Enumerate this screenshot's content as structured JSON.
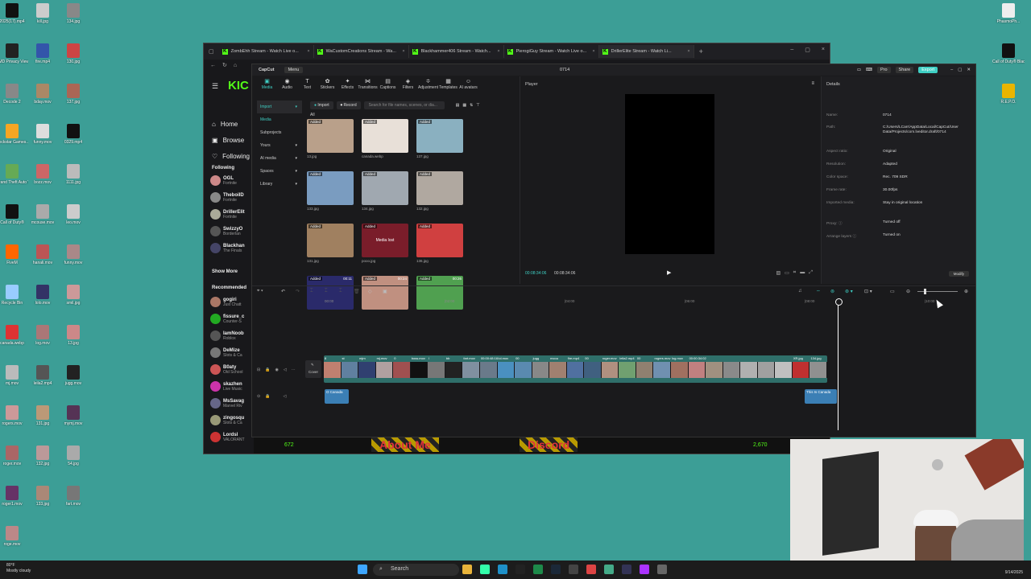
{
  "desktop": {
    "left_icons": [
      {
        "label": "2025(17).mp4",
        "color": "#111"
      },
      {
        "label": "kill.jpg",
        "color": "#ccc"
      },
      {
        "label": "134.jpg",
        "color": "#888"
      },
      {
        "label": "AMD Privacy View",
        "color": "#222"
      },
      {
        "label": "fire.mp4",
        "color": "#3355aa"
      },
      {
        "label": "130.jpg",
        "color": "#c44"
      },
      {
        "label": "Decode 2",
        "color": "#888"
      },
      {
        "label": "bday.mov",
        "color": "#aa8866"
      },
      {
        "label": "137.jpg",
        "color": "#aa6655"
      },
      {
        "label": "Rockstar Games...",
        "color": "#f5a623"
      },
      {
        "label": "funny.mov",
        "color": "#ddd"
      },
      {
        "label": "0329.mp4",
        "color": "#111"
      },
      {
        "label": "Grand Theft Auto V Leg...",
        "color": "#6a5"
      },
      {
        "label": "bozz.mov",
        "color": "#c66"
      },
      {
        "label": "1111.jpg",
        "color": "#bbb"
      },
      {
        "label": "Call of Duty®",
        "color": "#111"
      },
      {
        "label": "mcouse.mov",
        "color": "#aaa"
      },
      {
        "label": "leo.mov",
        "color": "#ccc"
      },
      {
        "label": "FiveM",
        "color": "#f60"
      },
      {
        "label": "hanali.mov",
        "color": "#b55"
      },
      {
        "label": "funny.mov",
        "color": "#a88"
      },
      {
        "label": "Recycle Bin",
        "color": "#9cf"
      },
      {
        "label": "lolo.mov",
        "color": "#336"
      },
      {
        "label": "smil.jpg",
        "color": "#c99"
      },
      {
        "label": "canada.webp",
        "color": "#d33"
      },
      {
        "label": "log.mov",
        "color": "#a77"
      },
      {
        "label": "13.jpg",
        "color": "#c88"
      },
      {
        "label": "mj.mov",
        "color": "#bbb"
      },
      {
        "label": "leila2.mp4",
        "color": "#555"
      },
      {
        "label": "jugg.mov",
        "color": "#222"
      },
      {
        "label": "rogers.mov",
        "color": "#c99"
      },
      {
        "label": "131.jpg",
        "color": "#b97"
      },
      {
        "label": "mymj.mov",
        "color": "#535"
      },
      {
        "label": "roger.mov",
        "color": "#a66"
      },
      {
        "label": "132.jpg",
        "color": "#b99"
      },
      {
        "label": "54.jpg",
        "color": "#aaa"
      },
      {
        "label": "roger1.mov",
        "color": "#636"
      },
      {
        "label": "133.jpg",
        "color": "#a87"
      },
      {
        "label": "fart.mov",
        "color": "#777"
      },
      {
        "label": "roge.mov",
        "color": "#b88"
      }
    ],
    "right_icons": [
      {
        "label": "PhasmoPh...",
        "color": "#eee"
      },
      {
        "label": "Call of Duty® Black...",
        "color": "#111"
      },
      {
        "label": "R.E.P.O.",
        "color": "#e9b500"
      }
    ]
  },
  "browser": {
    "tabs": [
      {
        "title": "ZombEhh Stream - Watch Live o..."
      },
      {
        "title": "WaCustomCreations Stream - Wa..."
      },
      {
        "title": "Blackhammer406 Stream - Watch..."
      },
      {
        "title": "PierogiGuy Stream - Watch Live o..."
      },
      {
        "title": "DrillerElite Stream - Watch Li..."
      }
    ],
    "close_glyph": "×",
    "new_tab_glyph": "+"
  },
  "kick": {
    "logo": "KIC",
    "nav": [
      {
        "label": "Home",
        "icon": "home-icon"
      },
      {
        "label": "Browse",
        "icon": "browse-icon"
      },
      {
        "label": "Following",
        "icon": "heart-icon"
      }
    ],
    "following_header": "Following",
    "following": [
      {
        "name": "OGL",
        "game": "Fortnite",
        "color": "#c88"
      },
      {
        "name": "TheboiID",
        "game": "Fortnite",
        "color": "#888"
      },
      {
        "name": "DrillerElit",
        "game": "Fortnite",
        "color": "#aa9"
      },
      {
        "name": "SwizzyO",
        "game": "Borderlan",
        "color": "#555"
      },
      {
        "name": "Blackhan",
        "game": "The Finals",
        "color": "#446"
      }
    ],
    "show_more": "Show More",
    "recommended_header": "Recommended",
    "recommended": [
      {
        "name": "gogiri",
        "game": "Just Chatt",
        "color": "#a76"
      },
      {
        "name": "fissure_c",
        "game": "Counter-S",
        "color": "#2a2"
      },
      {
        "name": "IamNoob",
        "game": "Roblox",
        "color": "#555"
      },
      {
        "name": "DeMize",
        "game": "Slots & Ca",
        "color": "#777"
      },
      {
        "name": "B0aty",
        "game": "Old School",
        "color": "#c55"
      },
      {
        "name": "skazhen",
        "game": "Live Music",
        "color": "#c3a"
      },
      {
        "name": "MsSavag",
        "game": "Marvel Riv",
        "color": "#668"
      },
      {
        "name": "zingosqu",
        "game": "Slots & Ca",
        "color": "#997"
      },
      {
        "name": "Lordsl",
        "game": "VALORANT",
        "color": "#c33"
      }
    ],
    "viewer_count": "672",
    "panels": [
      "About Me",
      "Discord"
    ],
    "viewer_count_2": "2,670"
  },
  "capcut": {
    "logo": "CapCut",
    "menu": "Menu",
    "project_name": "0714",
    "pro_label": "Pro",
    "share_label": "Share",
    "export_label": "Export",
    "toolbar": [
      {
        "label": "Media",
        "glyph": "▣",
        "active": true
      },
      {
        "label": "Audio",
        "glyph": "◉"
      },
      {
        "label": "Text",
        "glyph": "T"
      },
      {
        "label": "Stickers",
        "glyph": "✿"
      },
      {
        "label": "Effects",
        "glyph": "✦"
      },
      {
        "label": "Transitions",
        "glyph": "⋈"
      },
      {
        "label": "Captions",
        "glyph": "▤"
      },
      {
        "label": "Filters",
        "glyph": "◈"
      },
      {
        "label": "Adjustment",
        "glyph": "≑"
      },
      {
        "label": "Templates",
        "glyph": "▦"
      },
      {
        "label": "AI avatars",
        "glyph": "☺"
      }
    ],
    "media_side": [
      {
        "label": "Import",
        "style": "hl",
        "arrow": "▾"
      },
      {
        "label": "Media",
        "style": "act",
        "arrow": ""
      },
      {
        "label": "Subprojects",
        "style": "",
        "arrow": ""
      },
      {
        "label": "Yours",
        "style": "",
        "arrow": "▾"
      },
      {
        "label": "AI media",
        "style": "",
        "arrow": "▾"
      },
      {
        "label": "Spaces",
        "style": "",
        "arrow": "▾"
      },
      {
        "label": "Library",
        "style": "",
        "arrow": "▾"
      }
    ],
    "import_btn": "Import",
    "record_btn": "Record",
    "search_placeholder": "Search for file names, scenes, or dia...",
    "all_label": "All",
    "media": [
      {
        "name": "13.jpg",
        "badge": "Added",
        "dur": "",
        "color": "#b9a08a",
        "lost": ""
      },
      {
        "name": "canada.webp",
        "badge": "Added",
        "dur": "",
        "color": "#e8e0d8",
        "lost": ""
      },
      {
        "name": "137.jpg",
        "badge": "Added",
        "dur": "",
        "color": "#8ab0c0",
        "lost": ""
      },
      {
        "name": "133.jpg",
        "badge": "Added",
        "dur": "",
        "color": "#7a9cc0",
        "lost": ""
      },
      {
        "name": "134.jpg",
        "badge": "Added",
        "dur": "",
        "color": "#a0a8b0",
        "lost": ""
      },
      {
        "name": "132.jpg",
        "badge": "Added",
        "dur": "",
        "color": "#b0a8a0",
        "lost": ""
      },
      {
        "name": "131.jpg",
        "badge": "Added",
        "dur": "",
        "color": "#a08060",
        "lost": ""
      },
      {
        "name": "pooo.jpg",
        "badge": "Added",
        "dur": "",
        "color": "#7a1d2a",
        "lost": "Media lost"
      },
      {
        "name": "136.jpg",
        "badge": "Added",
        "dur": "",
        "color": "#d04040",
        "lost": ""
      },
      {
        "name": "",
        "badge": "Added",
        "dur": "00:11",
        "color": "#2a2a6a",
        "lost": ""
      },
      {
        "name": "",
        "badge": "Added",
        "dur": "00:24",
        "color": "#c09080",
        "lost": ""
      },
      {
        "name": "",
        "badge": "Added",
        "dur": "00:26",
        "color": "#50a050",
        "lost": ""
      }
    ],
    "player": {
      "header": "Player",
      "time_current": "00:08:34:06",
      "time_total": "00:08:34:06",
      "play_glyph": "▶"
    },
    "details": {
      "header": "Details",
      "rows": [
        {
          "k": "Name:",
          "v": "0714"
        },
        {
          "k": "Path:",
          "v": "C:/Users/LCarr/AppData/Local/CapCut/User Data/Projects/com.lveditor.draft/0714"
        },
        {
          "k": "Aspect ratio:",
          "v": "Original"
        },
        {
          "k": "Resolution:",
          "v": "Adapted"
        },
        {
          "k": "Color space:",
          "v": "Rec. 709 SDR"
        },
        {
          "k": "Frame rate:",
          "v": "30.00fps"
        },
        {
          "k": "Imported media:",
          "v": "Stay in original location"
        },
        {
          "k": "Proxy: ⓘ",
          "v": "Turned off"
        },
        {
          "k": "Arrange layers ⓘ",
          "v": "Turned on"
        }
      ],
      "modify": "Modify"
    },
    "ruler": [
      "00:00",
      "|02:00",
      "|04:00",
      "|06:00",
      "|08:00",
      "|10:00"
    ],
    "cover_label": "Cover",
    "clips": [
      {
        "label": "8 ",
        "color": "#c08070"
      },
      {
        "label": "st",
        "color": "#6080a0"
      },
      {
        "label": "mjm",
        "color": "#304070"
      },
      {
        "label": "mj.mov",
        "color": "#b0a0a0"
      },
      {
        "label": "0",
        "color": "#a05050"
      },
      {
        "label": "boss.mov",
        "color": "#111"
      },
      {
        "label": "l",
        "color": "#777"
      },
      {
        "label": "bb",
        "color": "#222"
      },
      {
        "label": "fart.mov",
        "color": "#8090a0"
      },
      {
        "label": "00:00:48:16",
        "color": "#6a7a8a"
      },
      {
        "label": "lol.mov",
        "color": "#4a90c0"
      },
      {
        "label": "00",
        "color": "#5a8ab0"
      },
      {
        "label": "jugg",
        "color": "#888"
      },
      {
        "label": "mcou",
        "color": "#a08070"
      },
      {
        "label": "fire.mp4",
        "color": "#5070a0"
      },
      {
        "label": "00",
        "color": "#406080"
      },
      {
        "label": "roger.mov",
        "color": "#b09080"
      },
      {
        "label": "leila2.mp4",
        "color": "#70a070"
      },
      {
        "label": "00",
        "color": "#908070"
      },
      {
        "label": "rogers.mov",
        "color": "#7090b0"
      },
      {
        "label": "log.mov",
        "color": "#a07060"
      },
      {
        "label": "00:00:34:02",
        "color": "#c08080"
      },
      {
        "label": "",
        "color": "#a09080"
      },
      {
        "label": "",
        "color": "#8a8a8a"
      },
      {
        "label": "",
        "color": "#b0b0b0"
      },
      {
        "label": "",
        "color": "#a0a0a0"
      },
      {
        "label": "",
        "color": "#c0c0c0"
      },
      {
        "label": "XR.jpg",
        "color": "#c03030"
      },
      {
        "label": "134.jpg",
        "color": "#909090"
      }
    ],
    "audio_clips": [
      {
        "label": "O Canada"
      },
      {
        "label": "This Is Canada"
      }
    ]
  },
  "taskbar": {
    "weather_temp": "80°F",
    "weather_desc": "Mostly cloudy",
    "search": "Search",
    "time": "",
    "date": "9/14/2025",
    "apps": [
      {
        "icon": "windows-icon",
        "color": "#3ea6ff"
      },
      {
        "icon": "widget-icon",
        "color": "#888"
      },
      {
        "icon": "file-explorer-icon",
        "color": "#e8b33a"
      },
      {
        "icon": "app-icon",
        "color": "#3fa"
      },
      {
        "icon": "edge-icon",
        "color": "#1e90c8"
      },
      {
        "icon": "app-icon",
        "color": "#222"
      },
      {
        "icon": "excel-icon",
        "color": "#1d8a4a"
      },
      {
        "icon": "steam-icon",
        "color": "#1b2838"
      },
      {
        "icon": "store-icon",
        "color": "#444"
      },
      {
        "icon": "chrome-icon",
        "color": "#d44"
      },
      {
        "icon": "app-icon",
        "color": "#4a8"
      },
      {
        "icon": "app-icon",
        "color": "#335"
      },
      {
        "icon": "app-icon",
        "color": "#a3f"
      },
      {
        "icon": "app-icon",
        "color": "#666"
      }
    ]
  }
}
